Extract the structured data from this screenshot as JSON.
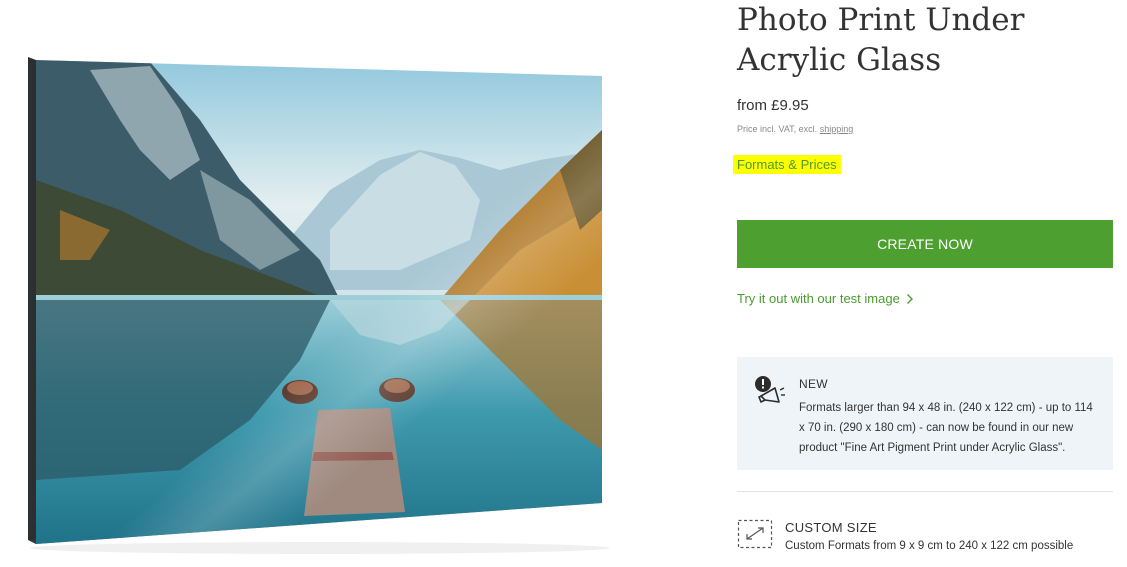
{
  "product": {
    "title": "Photo Print Under Acrylic Glass",
    "price": "from £9.95",
    "price_note_prefix": "Price incl. VAT, excl.",
    "price_note_link": "shipping",
    "formats_link": "Formats & Prices",
    "create_button": "CREATE NOW",
    "test_image_link": "Try it out with our test image"
  },
  "notice": {
    "heading": "NEW",
    "text": "Formats larger than 94 x 48 in. (240 x 122 cm) - up to 114 x 70 in. (290 x 180 cm) - can now be found in our new product \"Fine Art Pigment Print under Acrylic Glass\".",
    "icon": "megaphone-alert-icon"
  },
  "custom_size": {
    "heading": "CUSTOM SIZE",
    "text": "Custom Formats from 9 x 9 cm to 240 x 122 cm possible",
    "icon": "resize-frame-icon"
  },
  "colors": {
    "accent_green": "#4d9f2f",
    "link_green": "#4a9b2f",
    "highlight": "#ffff00",
    "notice_bg": "#eff4f8"
  }
}
